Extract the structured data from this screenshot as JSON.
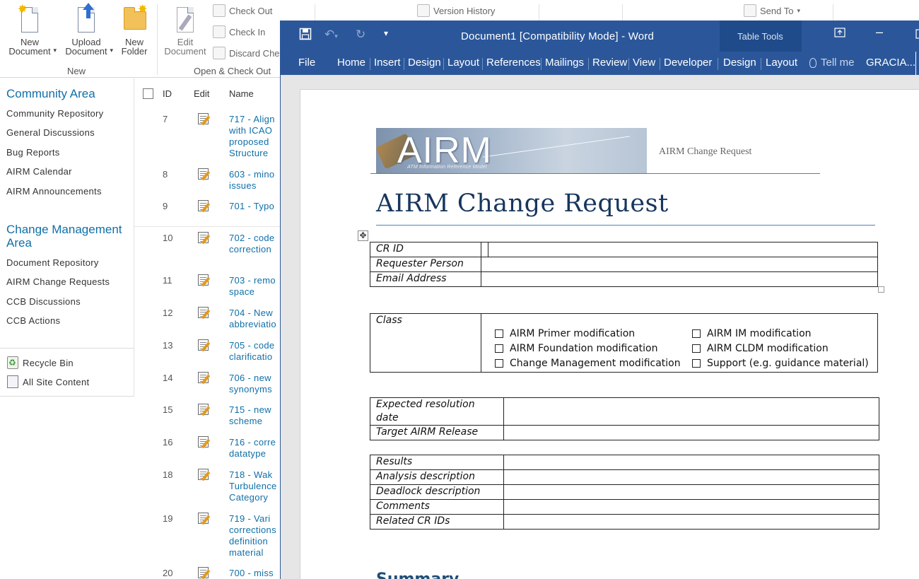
{
  "ribbon": {
    "new_document": "New\nDocument",
    "upload_document": "Upload\nDocument",
    "new_folder": "New\nFolder",
    "group_new": "New",
    "edit_document": "Edit\nDocument",
    "check_out": "Check Out",
    "check_in": "Check In",
    "discard_check_out": "Discard Che",
    "group_open_check_out": "Open & Check Out",
    "version_history": "Version History",
    "send_to": "Send To"
  },
  "nav": {
    "community_heading": "Community Area",
    "community_items": [
      "Community Repository",
      "General Discussions",
      "Bug Reports",
      "AIRM Calendar",
      "AIRM Announcements"
    ],
    "change_heading": "Change Management Area",
    "change_items": [
      "Document Repository",
      "AIRM Change Requests",
      "CCB Discussions",
      "CCB Actions"
    ],
    "recycle_bin": "Recycle Bin",
    "all_site_content": "All Site Content"
  },
  "list": {
    "headers": {
      "id": "ID",
      "edit": "Edit",
      "name": "Name"
    },
    "rows": [
      {
        "id": "7",
        "name": "717 - Align\nwith ICAO\nproposed\nStructure"
      },
      {
        "id": "8",
        "name": "603 - mino\nissues"
      },
      {
        "id": "9",
        "name": "701 - Typo"
      },
      {
        "id": "10",
        "name": "702 - code\ncorrection"
      },
      {
        "id": "11",
        "name": "703 - remo\nspace"
      },
      {
        "id": "12",
        "name": "704 - New\nabbreviatio"
      },
      {
        "id": "13",
        "name": "705 - code\nclarificatio"
      },
      {
        "id": "14",
        "name": "706 - new\nsynonyms"
      },
      {
        "id": "15",
        "name": "715 - new\nscheme"
      },
      {
        "id": "16",
        "name": "716 - corre\ndatatype"
      },
      {
        "id": "18",
        "name": "718 - Wak\nTurbulence\nCategory"
      },
      {
        "id": "19",
        "name": "719 - Vari\ncorrections\ndefinition\nmaterial"
      },
      {
        "id": "20",
        "name": "700 - miss"
      }
    ]
  },
  "word": {
    "title": "Document1 [Compatibility Mode] - Word",
    "table_tools": "Table Tools",
    "tabs": [
      "File",
      "Home",
      "Insert",
      "Design",
      "Layout",
      "References",
      "Mailings",
      "Review",
      "View",
      "Developer",
      "Design",
      "Layout"
    ],
    "tell_me": "Tell me",
    "user": "GRACIA..."
  },
  "doc": {
    "banner_logo": "AIRM",
    "banner_sub": "ATM Information Reference Model",
    "header_text": "AIRM Change Request",
    "title": "AIRM Change Request",
    "table1": [
      {
        "label": "CR ID",
        "value": ""
      },
      {
        "label": "Requester Person",
        "value": ""
      },
      {
        "label": "Email Address",
        "value": ""
      }
    ],
    "class_label": "Class",
    "class_options_left": [
      "AIRM Primer modification",
      "AIRM Foundation modification",
      "Change Management modification"
    ],
    "class_options_right": [
      "AIRM IM modification",
      "AIRM CLDM modification",
      "Support (e.g. guidance material)"
    ],
    "table3": [
      {
        "label": "Expected resolution date",
        "value": ""
      },
      {
        "label": "Target AIRM Release",
        "value": ""
      }
    ],
    "table4": [
      {
        "label": "Results",
        "value": ""
      },
      {
        "label": "Analysis description",
        "value": ""
      },
      {
        "label": "Deadlock description",
        "value": ""
      },
      {
        "label": "Comments",
        "value": ""
      },
      {
        "label": "Related CR IDs",
        "value": ""
      }
    ],
    "summary": "Summary"
  }
}
